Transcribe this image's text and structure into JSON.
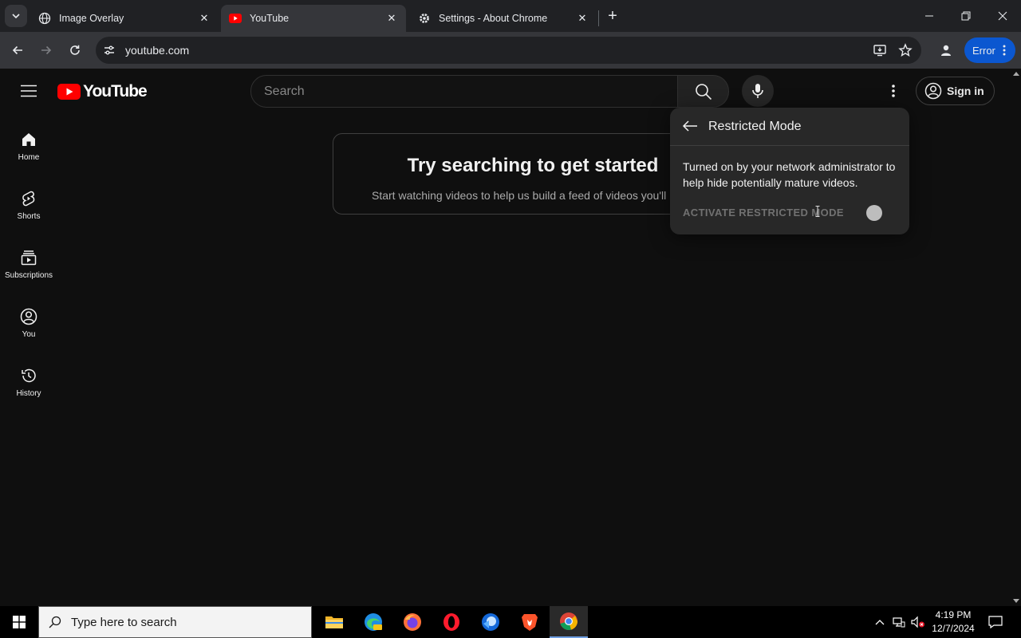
{
  "browser": {
    "tabs": [
      {
        "title": "Image Overlay",
        "favicon": "globe-icon",
        "active": false
      },
      {
        "title": "YouTube",
        "favicon": "youtube-favicon",
        "active": true
      },
      {
        "title": "Settings - About Chrome",
        "favicon": "gear-icon",
        "active": false
      }
    ],
    "url": "youtube.com",
    "profile_badge": "Error"
  },
  "youtube": {
    "logo_text": "YouTube",
    "search_placeholder": "Search",
    "signin_label": "Sign in",
    "nav": [
      {
        "label": "Home",
        "icon": "home-icon"
      },
      {
        "label": "Shorts",
        "icon": "shorts-icon"
      },
      {
        "label": "Subscriptions",
        "icon": "subscriptions-icon"
      },
      {
        "label": "You",
        "icon": "you-icon"
      },
      {
        "label": "History",
        "icon": "history-icon"
      }
    ],
    "prompt": {
      "title": "Try searching to get started",
      "subtitle": "Start watching videos to help us build a feed of videos you'll"
    },
    "restricted_popup": {
      "title": "Restricted Mode",
      "description": "Turned on by your network administrator to help hide potentially mature videos.",
      "toggle_label": "ACTIVATE RESTRICTED MODE",
      "toggle_on": false
    }
  },
  "taskbar": {
    "search_placeholder": "Type here to search",
    "time": "4:19 PM",
    "date": "12/7/2024",
    "apps": [
      "file-explorer-icon",
      "edge-icon",
      "firefox-icon",
      "opera-icon",
      "email-app-icon",
      "brave-icon",
      "chrome-icon"
    ]
  },
  "colors": {
    "youtube_red": "#ff0000",
    "chrome_profile_blue": "#0b57d0",
    "background": "#0f0f0f"
  }
}
